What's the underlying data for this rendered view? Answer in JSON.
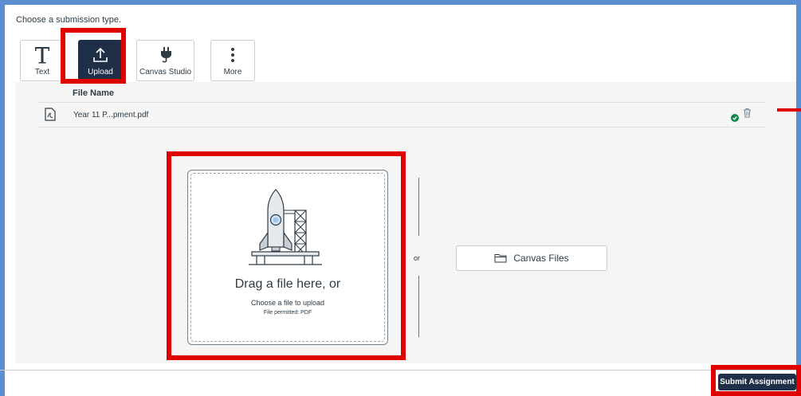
{
  "header": {
    "prompt": "Choose a submission type."
  },
  "submission_types": {
    "text": {
      "label": "Text",
      "icon": "text-T-icon"
    },
    "upload": {
      "label": "Upload",
      "icon": "upload-arrow-icon",
      "selected": true
    },
    "studio": {
      "label": "Canvas Studio",
      "icon": "plug-icon"
    },
    "more": {
      "label": "More",
      "icon": "vertical-ellipsis-icon"
    }
  },
  "files": {
    "column_header": "File Name",
    "items": [
      {
        "name": "Year 11 P...pment.pdf",
        "status": "uploaded",
        "icon": "pdf-file-icon"
      }
    ]
  },
  "dropzone": {
    "title": "Drag a file here, or",
    "subtitle": "Choose a file to upload",
    "permitted": "File permitted: PDF"
  },
  "divider": {
    "or_label": "or"
  },
  "canvas_files": {
    "label": "Canvas Files",
    "icon": "folder-icon"
  },
  "footer": {
    "submit_label": "Submit Assignment"
  },
  "colors": {
    "frame_border": "#5b8fd1",
    "highlight": "#e00000",
    "dark_navy": "#1f2f48",
    "success": "#0b874b",
    "panel_bg": "#f5f5f5"
  }
}
